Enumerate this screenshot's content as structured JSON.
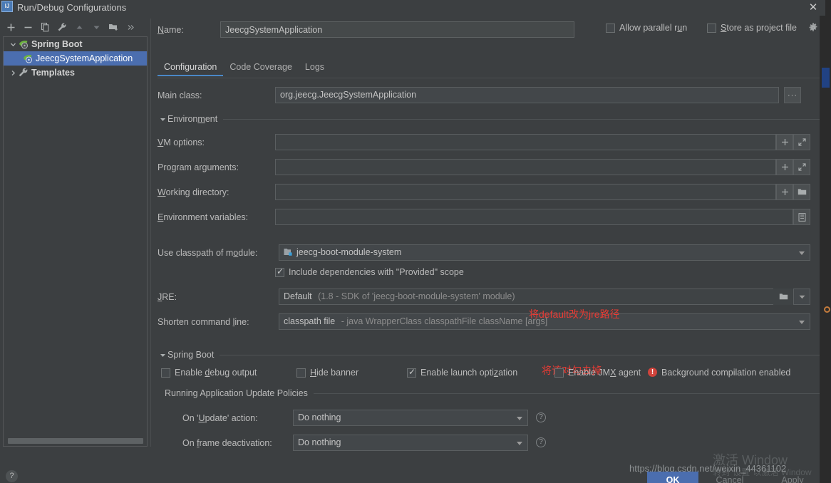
{
  "window": {
    "title": "Run/Debug Configurations",
    "app_icon": "intellij-idea-icon",
    "close_icon": "close-icon"
  },
  "toolbar": {
    "items": [
      {
        "name": "add-configuration-button",
        "icon": "plus-icon",
        "tooltip": "Add New Configuration"
      },
      {
        "name": "remove-configuration-button",
        "icon": "minus-icon",
        "tooltip": "Remove Configuration"
      },
      {
        "name": "copy-configuration-button",
        "icon": "copy-icon",
        "tooltip": "Copy Configuration"
      },
      {
        "name": "edit-templates-button",
        "icon": "wrench-icon",
        "tooltip": "Edit Templates"
      },
      {
        "name": "move-up-button",
        "icon": "arrow-up-icon",
        "tooltip": "Move Up"
      },
      {
        "name": "move-down-button",
        "icon": "arrow-down-icon",
        "tooltip": "Move Down"
      },
      {
        "name": "new-folder-button",
        "icon": "folder-add-icon",
        "tooltip": "Create New Folder"
      },
      {
        "name": "more-options-button",
        "icon": "chevron-double-right-icon",
        "tooltip": "More"
      }
    ]
  },
  "tree": {
    "nodes": [
      {
        "label": "Spring Boot",
        "icon": "spring-boot-icon",
        "expanded": true,
        "selected": false,
        "level": 0,
        "bold": true
      },
      {
        "label": "JeecgSystemApplication",
        "icon": "spring-boot-icon",
        "expanded": null,
        "selected": true,
        "level": 1,
        "bold": false
      },
      {
        "label": "Templates",
        "icon": "wrench-icon",
        "expanded": false,
        "selected": false,
        "level": 0,
        "bold": true
      }
    ]
  },
  "help": {
    "label": "?"
  },
  "name_row": {
    "label": "Name:",
    "label_mnemonic": "N",
    "value": "JeecgSystemApplication",
    "allow_parallel_run": {
      "label": "Allow parallel run",
      "checked": false
    },
    "store_as_project_file": {
      "label": "Store as project file",
      "checked": false
    },
    "gear_icon": "gear-icon"
  },
  "tabs": [
    {
      "label": "Configuration",
      "active": true
    },
    {
      "label": "Code Coverage",
      "active": false
    },
    {
      "label": "Logs",
      "active": false
    }
  ],
  "configuration": {
    "main_class": {
      "label": "Main class:",
      "value": "org.jeecg.JeecgSystemApplication",
      "browse_button": "..."
    },
    "environment_section": {
      "title": "Environment",
      "expanded": true
    },
    "vm_options": {
      "label": "VM options:",
      "value": "",
      "buttons": [
        "plus-icon",
        "expand-icon"
      ]
    },
    "program_arguments": {
      "label": "Program arguments:",
      "value": "",
      "buttons": [
        "plus-icon",
        "expand-icon"
      ]
    },
    "working_directory": {
      "label": "Working directory:",
      "value": "",
      "buttons": [
        "plus-icon",
        "folder-icon"
      ]
    },
    "environment_variables": {
      "label": "Environment variables:",
      "value": "",
      "buttons": [
        "list-icon"
      ]
    },
    "use_classpath_of_module": {
      "label": "Use classpath of module:",
      "value": "jeecg-boot-module-system",
      "icon": "module-icon"
    },
    "include_provided": {
      "label": "Include dependencies with \"Provided\" scope",
      "checked": true
    },
    "jre": {
      "label": "JRE:",
      "value": "Default",
      "value_hint": "(1.8 - SDK of 'jeecg-boot-module-system' module)",
      "buttons": [
        "folder-icon"
      ]
    },
    "shorten_command_line": {
      "label": "Shorten command line:",
      "value": "classpath file",
      "value_hint": "- java WrapperClass classpathFile className [args]"
    }
  },
  "spring_boot_section": {
    "title": "Spring Boot",
    "expanded": true,
    "checkboxes": [
      {
        "label": "Enable debug output",
        "checked": false,
        "name": "enable-debug-output-checkbox"
      },
      {
        "label": "Hide banner",
        "checked": false,
        "name": "hide-banner-checkbox"
      },
      {
        "label": "Enable launch optimization",
        "checked": true,
        "name": "enable-launch-optimization-checkbox"
      },
      {
        "label": "Enable JMX agent",
        "checked": false,
        "name": "enable-jmx-agent-checkbox"
      }
    ],
    "background_compilation": {
      "label": "Background compilation enabled",
      "icon": "error-icon",
      "icon_color": "#d0443c"
    }
  },
  "update_policies": {
    "title": "Running Application Update Policies",
    "on_update_action": {
      "label": "On 'Update' action:",
      "value": "Do nothing",
      "help_icon": "question-icon"
    },
    "on_frame_deactivation": {
      "label": "On frame deactivation:",
      "value": "Do nothing",
      "help_icon": "question-icon"
    }
  },
  "annotations": [
    {
      "text": "将default改为jre路径",
      "color": "#e83b34",
      "name": "annotation-jre-path"
    },
    {
      "text": "将该对勾去掉",
      "color": "#e83b34",
      "name": "annotation-uncheck"
    }
  ],
  "footer": {
    "ok": "OK",
    "cancel": "Cancel",
    "apply": "Apply"
  },
  "watermarks": {
    "csdn": "https://blog.csdn.net/weixin_44361102",
    "windows_line1": "激活 Window",
    "windows_line2": "转到\"设置\"以激活 Window"
  }
}
